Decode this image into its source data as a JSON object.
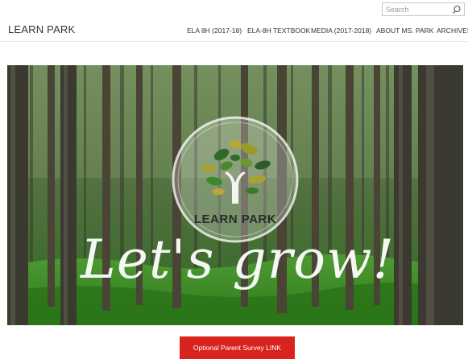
{
  "header": {
    "search": {
      "placeholder": "Search",
      "icon": "search-icon"
    },
    "brand": "LEARN PARK",
    "nav": [
      {
        "label": "ELA 8H (2017-18)"
      },
      {
        "label": "ELA-8H TEXTBOOK"
      },
      {
        "label": "MEDIA (2017-2018)"
      },
      {
        "label": "ABOUT MS. PARK"
      },
      {
        "label": "ARCHIVES"
      }
    ]
  },
  "hero": {
    "logo_text": "LEARN PARK",
    "tagline": "Let's grow!"
  },
  "survey_button": {
    "label": "Optional Parent Survey LINK"
  },
  "colors": {
    "accent_red": "#d9231e",
    "forest_green": "#3f7a2c",
    "logo_dark_green": "#2f5a2a",
    "leaf_olive": "#a8a232"
  }
}
